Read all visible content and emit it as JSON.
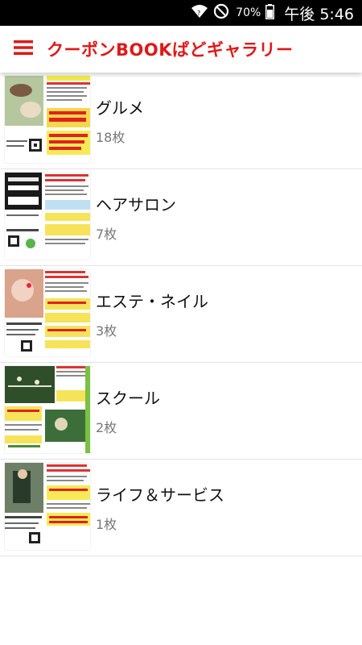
{
  "status_bar": {
    "battery_percent": "70%",
    "time": "午後 5:46",
    "icons": [
      "wifi-icon",
      "do-not-disturb-icon",
      "battery-icon"
    ]
  },
  "app_bar": {
    "title": "クーポンBOOKぱどギャラリー",
    "menu_icon": "hamburger-menu-icon",
    "accent_color": "#e01818"
  },
  "categories": [
    {
      "name": "グルメ",
      "count": "18枚"
    },
    {
      "name": "ヘアサロン",
      "count": "7枚"
    },
    {
      "name": "エステ・ネイル",
      "count": "3枚"
    },
    {
      "name": "スクール",
      "count": "2枚"
    },
    {
      "name": "ライフ＆サービス",
      "count": "1枚"
    }
  ]
}
